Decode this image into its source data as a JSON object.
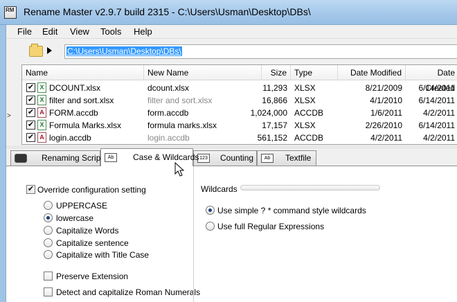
{
  "window": {
    "title": "Rename Master v2.9.7 build 2315 - C:\\Users\\Usman\\Desktop\\DBs\\",
    "app_icon_text": "RM"
  },
  "menu": [
    "File",
    "Edit",
    "View",
    "Tools",
    "Help"
  ],
  "path": {
    "value": "C:\\Users\\Usman\\Desktop\\DBs\\"
  },
  "file_list": {
    "columns": [
      "Name",
      "New Name",
      "Size",
      "Type",
      "Date Modified",
      "Date Created"
    ],
    "rows": [
      {
        "name": "DCOUNT.xlsx",
        "new_name": "dcount.xlsx",
        "size": "11,293",
        "type": "XLSX",
        "modified": "8/21/2009",
        "created": "6/14/2011",
        "icon": "X",
        "changed": true
      },
      {
        "name": "filter and sort.xlsx",
        "new_name": "filter and sort.xlsx",
        "size": "16,866",
        "type": "XLSX",
        "modified": "4/1/2010",
        "created": "6/14/2011",
        "icon": "X",
        "changed": false
      },
      {
        "name": "FORM.accdb",
        "new_name": "form.accdb",
        "size": "1,024,000",
        "type": "ACCDB",
        "modified": "1/6/2011",
        "created": "4/2/2011",
        "icon": "A",
        "changed": true
      },
      {
        "name": "Formula Marks.xlsx",
        "new_name": "formula marks.xlsx",
        "size": "17,157",
        "type": "XLSX",
        "modified": "2/26/2010",
        "created": "6/14/2011",
        "icon": "X",
        "changed": true
      },
      {
        "name": "login.accdb",
        "new_name": "login.accdb",
        "size": "561,152",
        "type": "ACCDB",
        "modified": "4/2/2011",
        "created": "4/2/2011",
        "icon": "A",
        "changed": false
      }
    ]
  },
  "tabs": [
    {
      "label": "Renaming Script",
      "icon_text": "",
      "active": false
    },
    {
      "label": "Case & Wildcards",
      "icon_text": "Ab",
      "active": true
    },
    {
      "label": "Counting",
      "icon_text": "123",
      "active": false
    },
    {
      "label": "Textfile",
      "icon_text": "Ab",
      "active": false
    }
  ],
  "case_options": {
    "override_label": "Override configuration setting",
    "override_checked": true,
    "radios": [
      {
        "label": "UPPERCASE",
        "selected": false
      },
      {
        "label": "lowercase",
        "selected": true
      },
      {
        "label": "Capitalize Words",
        "selected": false
      },
      {
        "label": "Capitalize sentence",
        "selected": false
      },
      {
        "label": "Capitalize with Title Case",
        "selected": false
      }
    ],
    "preserve_extension": "Preserve Extension",
    "roman_numerals": "Detect and capitalize Roman Numerals"
  },
  "wildcards": {
    "title": "Wildcards",
    "options": [
      {
        "label": "Use simple ? * command style wildcards",
        "selected": true
      },
      {
        "label": "Use full Regular Expressions",
        "selected": false
      }
    ]
  },
  "colors": {
    "selection": "#3399ff",
    "titlebar": "#a5c8ea",
    "radio_dot": "#1b3f7a"
  },
  "misc": {
    "check_mark": "✔",
    "left_arrow": ">"
  }
}
